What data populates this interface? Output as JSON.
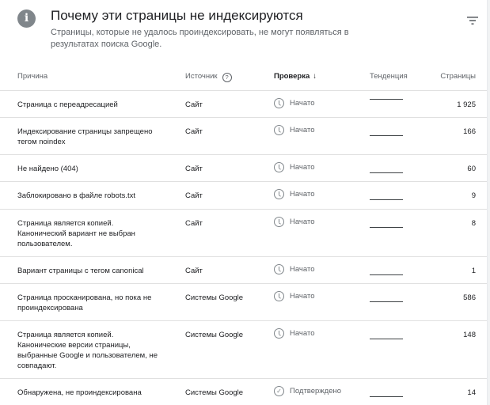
{
  "header": {
    "title": "Почему эти страницы не индексируются",
    "subtitle": "Страницы, которые не удалось проиндексировать, не могут появляться в результатах поиска Google.",
    "info_icon": "info-icon",
    "filter_icon": "filter-icon"
  },
  "columns": {
    "reason": "Причина",
    "source": "Источник",
    "check": "Проверка",
    "trend": "Тенденция",
    "pages": "Страницы"
  },
  "rows": [
    {
      "reason": "Страница с переадресацией",
      "source": "Сайт",
      "status": "Начато",
      "status_icon": "clock-icon",
      "pages": "1 925"
    },
    {
      "reason": "Индексирование страницы запрещено\nтегом noindex",
      "source": "Сайт",
      "status": "Начато",
      "status_icon": "clock-icon",
      "pages": "166"
    },
    {
      "reason": "Не найдено (404)",
      "source": "Сайт",
      "status": "Начато",
      "status_icon": "clock-icon",
      "pages": "60"
    },
    {
      "reason": "Заблокировано в файле robots.txt",
      "source": "Сайт",
      "status": "Начато",
      "status_icon": "clock-icon",
      "pages": "9"
    },
    {
      "reason": "Страница является копией.\nКанонический вариант не выбран\nпользователем.",
      "source": "Сайт",
      "status": "Начато",
      "status_icon": "clock-icon",
      "pages": "8"
    },
    {
      "reason": "Вариант страницы с тегом canonical",
      "source": "Сайт",
      "status": "Начато",
      "status_icon": "clock-icon",
      "pages": "1"
    },
    {
      "reason": "Страница просканирована, но пока не\nпроиндексирована",
      "source": "Системы Google",
      "status": "Начато",
      "status_icon": "clock-icon",
      "pages": "586"
    },
    {
      "reason": "Страница является копией.\nКанонические версии страницы,\nвыбранные Google и пользователем, не\nсовпадают.",
      "source": "Системы Google",
      "status": "Начато",
      "status_icon": "clock-icon",
      "pages": "148"
    },
    {
      "reason": "Обнаружена, не проиндексирована",
      "source": "Системы Google",
      "status": "Подтверждено",
      "status_icon": "check-circle-icon",
      "pages": "14"
    }
  ]
}
